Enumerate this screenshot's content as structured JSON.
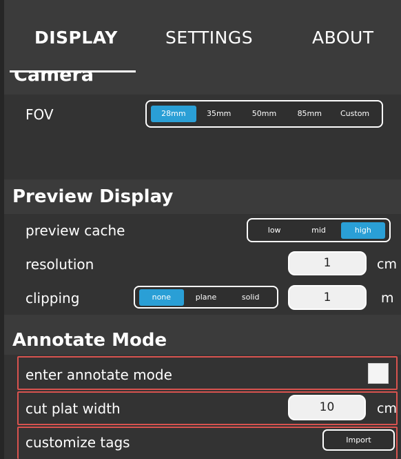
{
  "tabs": [
    {
      "label": "DISPLAY",
      "active": true
    },
    {
      "label": "SETTINGS",
      "active": false
    },
    {
      "label": "ABOUT",
      "active": false
    }
  ],
  "camera": {
    "title": "Camera",
    "fov": {
      "label": "FOV",
      "options": [
        "28mm",
        "35mm",
        "50mm",
        "85mm",
        "Custom"
      ],
      "selected": "28mm"
    }
  },
  "preview_display": {
    "title": "Preview Display",
    "preview_cache": {
      "label": "preview cache",
      "options": [
        "low",
        "mid",
        "high"
      ],
      "selected": "high"
    },
    "resolution": {
      "label": "resolution",
      "value": "1",
      "unit": "cm"
    },
    "clipping": {
      "label": "clipping",
      "options": [
        "none",
        "plane",
        "solid"
      ],
      "selected": "none",
      "value": "1",
      "unit": "m"
    }
  },
  "annotate_mode": {
    "title": "Annotate Mode",
    "enter": {
      "label": "enter annotate mode",
      "checked": false
    },
    "cut_plat_width": {
      "label": "cut plat width",
      "value": "10",
      "unit": "cm"
    },
    "customize_tags": {
      "label": "customize tags",
      "button": "Import"
    }
  },
  "colors": {
    "accent": "#2a9fd6",
    "highlight": "#d9534f",
    "background": "#3b3b3b",
    "row": "#333333"
  }
}
